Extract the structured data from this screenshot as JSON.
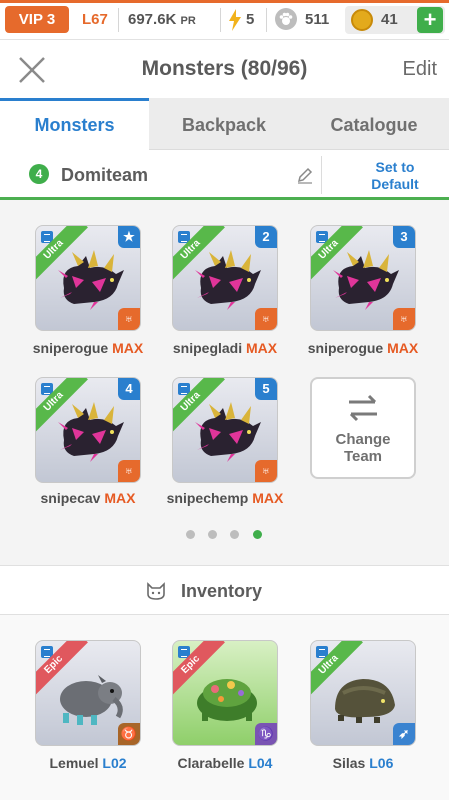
{
  "status": {
    "vip": "VIP 3",
    "level": "L67",
    "pr_value": "697.6K",
    "pr_unit": "PR",
    "energy": "5",
    "paw_count": "511",
    "coins": "41",
    "add": "+"
  },
  "header": {
    "title": "Monsters (80/96)",
    "edit": "Edit"
  },
  "tabs": [
    {
      "label": "Monsters"
    },
    {
      "label": "Backpack"
    },
    {
      "label": "Catalogue"
    }
  ],
  "team": {
    "number": "4",
    "name": "Domiteam",
    "set_default_line1": "Set to",
    "set_default_line2": "Default"
  },
  "team_monsters": [
    {
      "name": "sniperogue",
      "badge": "MAX",
      "rarity": "Ultra",
      "slot": "★",
      "element": "♅"
    },
    {
      "name": "snipegladi",
      "badge": "MAX",
      "rarity": "Ultra",
      "slot": "2",
      "element": "♅"
    },
    {
      "name": "sniperogue",
      "badge": "MAX",
      "rarity": "Ultra",
      "slot": "3",
      "element": "♅"
    },
    {
      "name": "snipecav",
      "badge": "MAX",
      "rarity": "Ultra",
      "slot": "4",
      "element": "♅"
    },
    {
      "name": "snipechemp",
      "badge": "MAX",
      "rarity": "Ultra",
      "slot": "5",
      "element": "♅"
    }
  ],
  "change_team": {
    "line1": "Change",
    "line2": "Team"
  },
  "pagination": {
    "pages": 4,
    "current": 4
  },
  "inventory": {
    "title": "Inventory",
    "items": [
      {
        "name": "Lemuel",
        "level": "L02",
        "rarity": "Epic",
        "element": "♉"
      },
      {
        "name": "Clarabelle",
        "level": "L04",
        "rarity": "Epic",
        "element": "♑"
      },
      {
        "name": "Silas",
        "level": "L06",
        "rarity": "Ultra",
        "element": "➶"
      }
    ]
  },
  "colors": {
    "accent_blue": "#2a7fce",
    "orange": "#e66a2c",
    "green": "#3fae4b",
    "max_red": "#e65a23"
  }
}
